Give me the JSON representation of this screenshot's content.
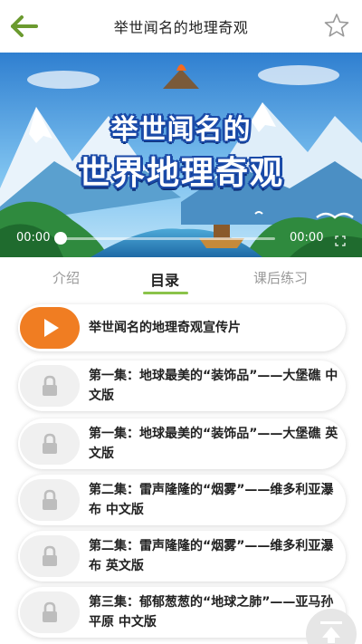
{
  "header": {
    "title": "举世闻名的地理奇观",
    "back_icon": "back-arrow-icon",
    "favorite_icon": "star-outline-icon",
    "accent_color": "#6b9a2f"
  },
  "video": {
    "banner_line1": "举世闻名的",
    "banner_line2": "世界地理奇观",
    "current_time": "00:00",
    "total_time": "00:00",
    "progress": 0,
    "fullscreen_icon": "fullscreen-icon"
  },
  "tabs": [
    {
      "label": "介绍",
      "active": false
    },
    {
      "label": "目录",
      "active": true
    },
    {
      "label": "课后练习",
      "active": false
    }
  ],
  "tab_accent_color": "#8bc34a",
  "episodes": [
    {
      "title": "举世闻名的地理奇观宣传片",
      "icon": "play-icon",
      "locked": false
    },
    {
      "title": "第一集：地球最美的“装饰品”——大堡礁 中文版",
      "icon": "lock-icon",
      "locked": true
    },
    {
      "title": "第一集：地球最美的“装饰品”——大堡礁 英文版",
      "icon": "lock-icon",
      "locked": true
    },
    {
      "title": "第二集：雷声隆隆的“烟雾”——维多利亚瀑布 中文版",
      "icon": "lock-icon",
      "locked": true
    },
    {
      "title": "第二集：雷声隆隆的“烟雾”——维多利亚瀑布 英文版",
      "icon": "lock-icon",
      "locked": true
    },
    {
      "title": "第三集：郁郁葱葱的“地球之肺”——亚马孙平原 中文版",
      "icon": "lock-icon",
      "locked": true
    }
  ],
  "play_color": "#f07d22",
  "scroll_top_icon": "scroll-to-top-icon"
}
